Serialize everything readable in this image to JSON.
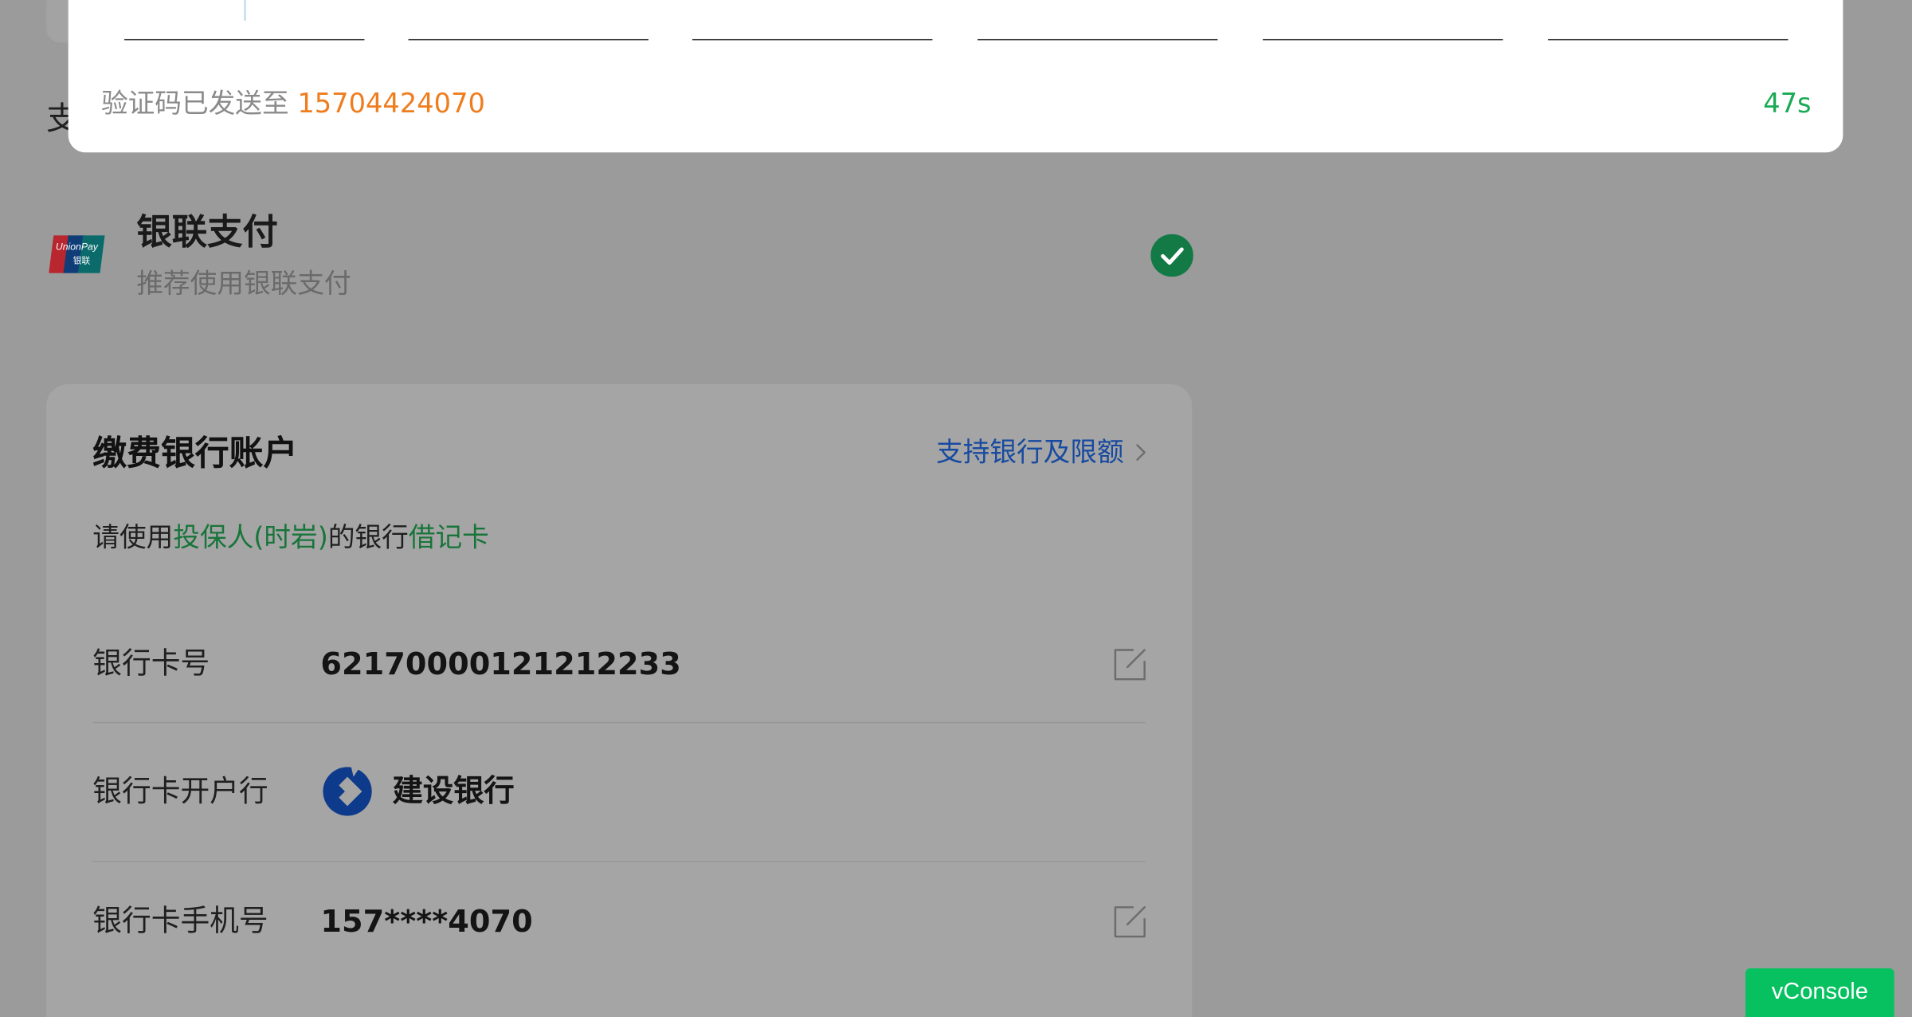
{
  "background_section": {
    "section_title_partial": "支"
  },
  "verify_modal": {
    "code_slots": [
      "",
      "",
      "",
      "",
      "",
      ""
    ],
    "sent_label": "验证码已发送至",
    "sent_phone": "15704424070",
    "countdown": "47s"
  },
  "payment_method": {
    "logo_text": "UnionPay",
    "logo_text_cn": "银联",
    "title": "银联支付",
    "subtitle": "推荐使用银联支付",
    "selected": true
  },
  "bank_account": {
    "title": "缴费银行账户",
    "support_link": "支持银行及限额",
    "hint_prefix": "请使用",
    "hint_holder": "投保人(时岩)",
    "hint_middle": "的银行",
    "hint_card_type": "借记卡",
    "rows": [
      {
        "label": "银行卡号",
        "value": "62170000121212233",
        "icon": "edit-icon"
      },
      {
        "label": "银行卡开户行",
        "value": "建设银行",
        "icon": "ccb-logo-icon"
      },
      {
        "label": "银行卡手机号",
        "value": "157****4070",
        "icon": "edit-icon"
      }
    ]
  },
  "vconsole": {
    "label": "vConsole"
  },
  "colors": {
    "accent_green": "#1aaa55",
    "phone_orange": "#ef7d1e",
    "link_blue": "#174aa0",
    "vconsole_green": "#07c160"
  }
}
